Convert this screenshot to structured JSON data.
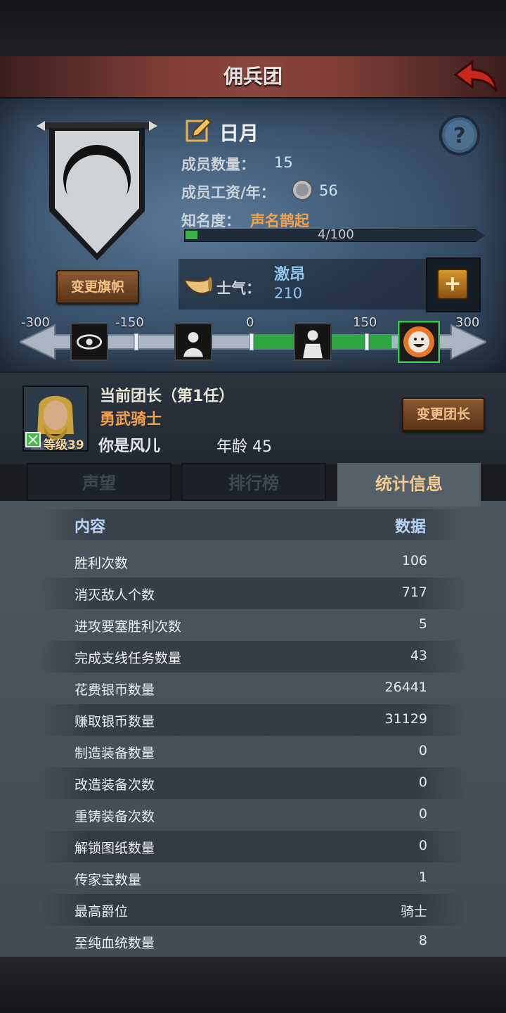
{
  "header": {
    "title": "佣兵团"
  },
  "guild": {
    "name": "日月",
    "members_label": "成员数量：",
    "members_value": "15",
    "wage_label": "成员工资/年：",
    "wage_value": "56",
    "fame_label": "知名度：",
    "fame_value": "声名鹊起",
    "fame_progress_text": "4/100",
    "fame_progress": 0.04,
    "change_banner_label": "变更旗帜"
  },
  "morale": {
    "label": "士气：",
    "state": "激昂",
    "value": "210",
    "ticks": [
      "-300",
      "-150",
      "0",
      "150",
      "300"
    ],
    "icons": [
      "panic-icon",
      "despair-icon",
      "calm-icon",
      "excited-icon"
    ],
    "value_numeric": 210
  },
  "leader": {
    "title": "当前团长（第1任）",
    "class": "勇武骑士",
    "name": "你是风儿",
    "age": "年龄 45",
    "level": "等级39",
    "change_label": "变更团长"
  },
  "tabs": [
    {
      "label": "声望",
      "active": false
    },
    {
      "label": "排行榜",
      "active": false
    },
    {
      "label": "统计信息",
      "active": true
    }
  ],
  "stats": {
    "header_content": "内容",
    "header_data": "数据",
    "rows": [
      {
        "k": "胜利次数",
        "v": "106"
      },
      {
        "k": "消灭敌人个数",
        "v": "717"
      },
      {
        "k": "进攻要塞胜利次数",
        "v": "5"
      },
      {
        "k": "完成支线任务数量",
        "v": "43"
      },
      {
        "k": "花费银币数量",
        "v": "26441"
      },
      {
        "k": "赚取银币数量",
        "v": "31129"
      },
      {
        "k": "制造装备数量",
        "v": "0"
      },
      {
        "k": "改造装备次数",
        "v": "0"
      },
      {
        "k": "重铸装备次数",
        "v": "0"
      },
      {
        "k": "解锁图纸数量",
        "v": "0"
      },
      {
        "k": "传家宝数量",
        "v": "1"
      },
      {
        "k": "最高爵位",
        "v": "骑士"
      },
      {
        "k": "至纯血统数量",
        "v": "8"
      }
    ]
  },
  "colors": {
    "accent_orange": "#f0a04a",
    "morale_green": "#39b24a",
    "label_blue": "#b6d5f5",
    "header_red": "#8a463e"
  }
}
